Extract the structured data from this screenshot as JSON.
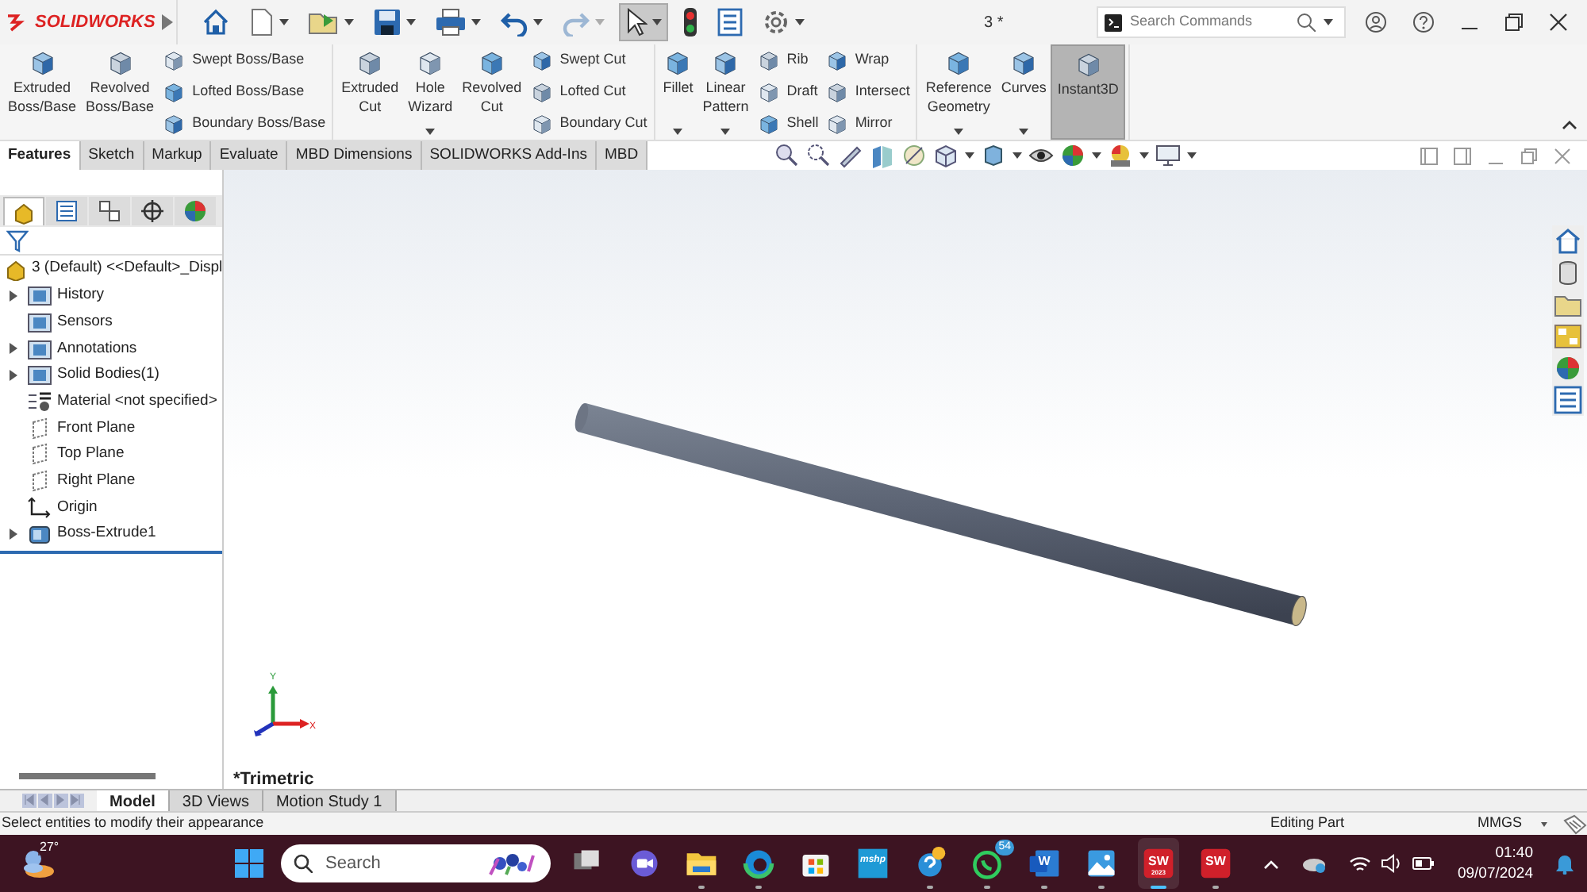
{
  "app": {
    "logo": "SOLIDWORKS",
    "document_title": "3 *",
    "search": {
      "placeholder": "Search Commands"
    }
  },
  "quick_access": [
    {
      "kind": "home",
      "selected": false,
      "disabled": false,
      "menu": false
    },
    {
      "kind": "new",
      "selected": false,
      "disabled": false,
      "menu": true
    },
    {
      "kind": "open",
      "selected": false,
      "disabled": false,
      "menu": true
    },
    {
      "kind": "save",
      "selected": false,
      "disabled": false,
      "menu": true
    },
    {
      "kind": "print",
      "selected": false,
      "disabled": false,
      "menu": true
    },
    {
      "kind": "undo",
      "selected": false,
      "disabled": false,
      "menu": true
    },
    {
      "kind": "redo",
      "selected": false,
      "disabled": true,
      "menu": true
    },
    {
      "kind": "select",
      "selected": true,
      "disabled": false,
      "menu": true
    },
    {
      "kind": "rebuild",
      "selected": false,
      "disabled": false,
      "menu": false
    },
    {
      "kind": "properties",
      "selected": false,
      "disabled": false,
      "menu": false
    },
    {
      "kind": "options",
      "selected": false,
      "disabled": false,
      "menu": true
    }
  ],
  "ribbon": {
    "groups": [
      {
        "items": [
          {
            "kind": "large",
            "label": "Extruded\nBoss/Base",
            "dropdown": false,
            "selected": false
          },
          {
            "kind": "large",
            "label": "Revolved\nBoss/Base",
            "dropdown": false,
            "selected": false
          },
          {
            "kind": "column",
            "items": [
              "Swept Boss/Base",
              "Lofted Boss/Base",
              "Boundary Boss/Base"
            ]
          }
        ]
      },
      {
        "items": [
          {
            "kind": "large",
            "label": "Extruded\nCut",
            "dropdown": false,
            "selected": false
          },
          {
            "kind": "large",
            "label": "Hole\nWizard",
            "dropdown": true,
            "selected": false
          },
          {
            "kind": "large",
            "label": "Revolved\nCut",
            "dropdown": false,
            "selected": false
          },
          {
            "kind": "column",
            "items": [
              "Swept Cut",
              "Lofted Cut",
              "Boundary Cut"
            ]
          }
        ]
      },
      {
        "items": [
          {
            "kind": "large",
            "label": "Fillet",
            "dropdown": true,
            "selected": false
          },
          {
            "kind": "large",
            "label": "Linear\nPattern",
            "dropdown": true,
            "selected": false
          },
          {
            "kind": "column",
            "items": [
              "Rib",
              "Draft",
              "Shell"
            ]
          },
          {
            "kind": "column",
            "items": [
              "Wrap",
              "Intersect",
              "Mirror"
            ]
          }
        ]
      },
      {
        "items": [
          {
            "kind": "large",
            "label": "Reference\nGeometry",
            "dropdown": true,
            "selected": false
          },
          {
            "kind": "large",
            "label": "Curves",
            "dropdown": true,
            "selected": false
          },
          {
            "kind": "large",
            "label": "Instant3D",
            "dropdown": false,
            "selected": true
          }
        ]
      }
    ]
  },
  "tabs": [
    {
      "label": "Features",
      "selected": true
    },
    {
      "label": "Sketch",
      "selected": false
    },
    {
      "label": "Markup",
      "selected": false
    },
    {
      "label": "Evaluate",
      "selected": false
    },
    {
      "label": "MBD Dimensions",
      "selected": false
    },
    {
      "label": "SOLIDWORKS Add-Ins",
      "selected": false
    },
    {
      "label": "MBD",
      "selected": false
    }
  ],
  "panel_tabs": [
    {
      "kind": "feature_tree",
      "selected": true
    },
    {
      "kind": "property",
      "selected": false
    },
    {
      "kind": "configuration",
      "selected": false
    },
    {
      "kind": "dimxpert",
      "selected": false
    },
    {
      "kind": "display",
      "selected": false
    }
  ],
  "tree": {
    "root": "3 (Default) <<Default>_Displ",
    "items": [
      {
        "label": "History",
        "kind": "folder",
        "expandable": true
      },
      {
        "label": "Sensors",
        "kind": "folder",
        "expandable": false
      },
      {
        "label": "Annotations",
        "kind": "folder",
        "expandable": true
      },
      {
        "label": "Solid Bodies(1)",
        "kind": "folder",
        "expandable": true
      },
      {
        "label": "Material <not specified>",
        "kind": "material",
        "expandable": false
      },
      {
        "label": "Front Plane",
        "kind": "plane",
        "expandable": false
      },
      {
        "label": "Top Plane",
        "kind": "plane",
        "expandable": false
      },
      {
        "label": "Right Plane",
        "kind": "plane",
        "expandable": false
      },
      {
        "label": "Origin",
        "kind": "origin",
        "expandable": false
      },
      {
        "label": "Boss-Extrude1",
        "kind": "feature",
        "expandable": true
      }
    ]
  },
  "viewport": {
    "view_name": "*Trimetric",
    "axes": [
      "Y",
      "X"
    ]
  },
  "bottom_tabs": [
    {
      "label": "Model",
      "selected": true
    },
    {
      "label": "3D Views",
      "selected": false
    },
    {
      "label": "Motion Study 1",
      "selected": false
    }
  ],
  "status_bar": {
    "message": "Select entities to modify their appearance",
    "mode": "Editing Part",
    "units": "MMGS"
  },
  "taskbar": {
    "weather": "27°",
    "search": {
      "placeholder": "Search"
    },
    "apps": [
      {
        "kind": "taskview",
        "running": false,
        "active": false
      },
      {
        "kind": "meet",
        "running": false,
        "active": false
      },
      {
        "kind": "files",
        "running": true,
        "active": false
      },
      {
        "kind": "edge",
        "running": true,
        "active": false
      },
      {
        "kind": "store",
        "running": false,
        "active": false
      },
      {
        "kind": "mshp",
        "label": "mshp",
        "running": false,
        "active": false
      },
      {
        "kind": "help",
        "running": true,
        "active": false
      },
      {
        "kind": "whatsapp",
        "badge": "54",
        "running": true,
        "active": false
      },
      {
        "kind": "word",
        "label": "W",
        "running": true,
        "active": false
      },
      {
        "kind": "photos",
        "running": true,
        "active": false
      },
      {
        "kind": "solidworks",
        "label": "SW",
        "sublabel": "2023",
        "running": true,
        "active": true
      },
      {
        "kind": "solidworks",
        "label": "SW",
        "running": true,
        "active": false
      }
    ],
    "time": "01:40",
    "date": "09/07/2024"
  }
}
